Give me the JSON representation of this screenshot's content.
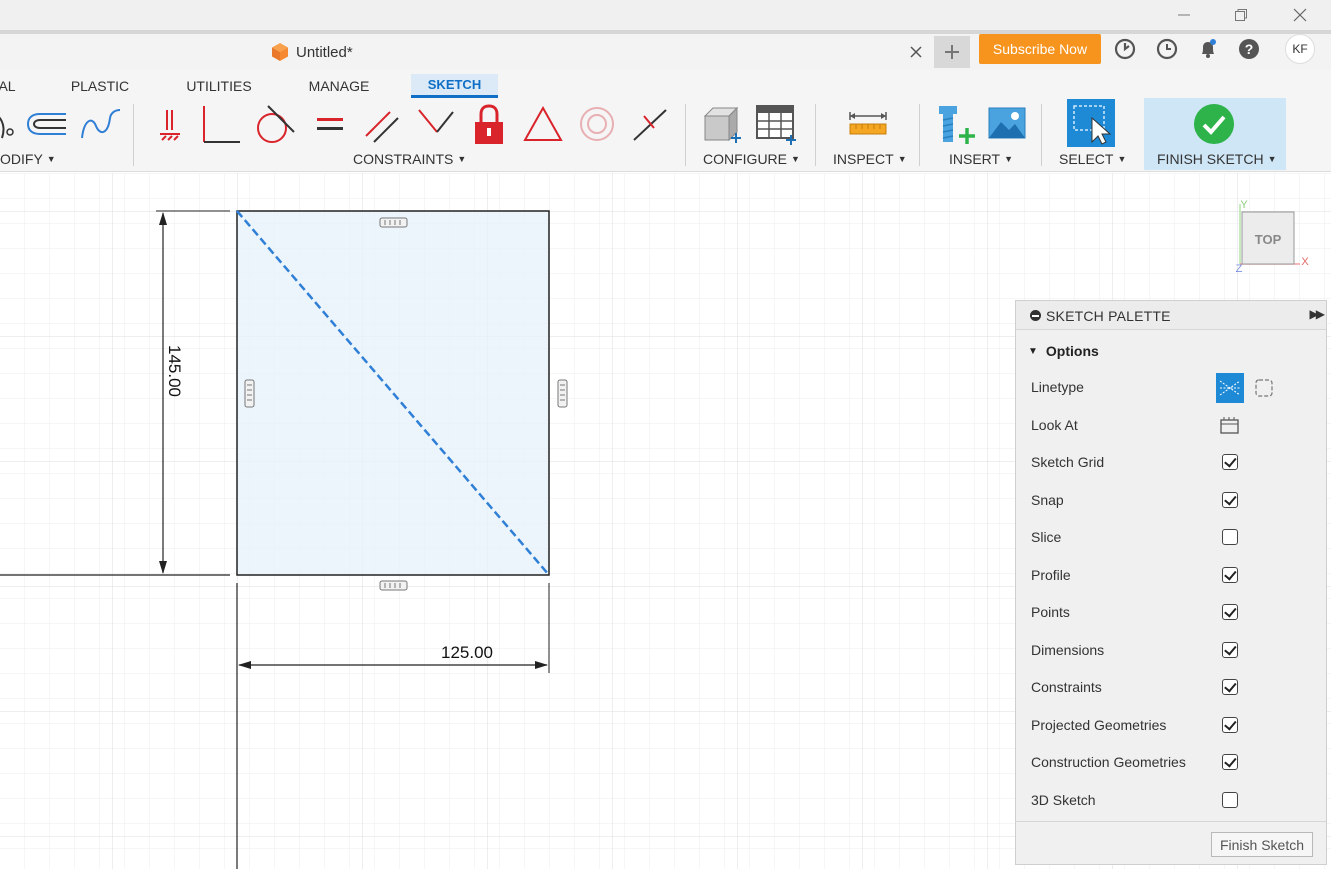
{
  "document": {
    "title": "Untitled*"
  },
  "header": {
    "subscribe_label": "Subscribe Now",
    "avatar_initials": "KF"
  },
  "ribbon_tabs": [
    {
      "label": "AL"
    },
    {
      "label": "PLASTIC"
    },
    {
      "label": "UTILITIES"
    },
    {
      "label": "MANAGE"
    },
    {
      "label": "SKETCH",
      "active": true
    }
  ],
  "toolbar": {
    "groups": {
      "modify": "ODIFY",
      "constraints": "CONSTRAINTS",
      "configure": "CONFIGURE",
      "inspect": "INSPECT",
      "insert": "INSERT",
      "select": "SELECT",
      "finish_sketch": "FINISH SKETCH"
    }
  },
  "sketch": {
    "dimension_vertical": "145.00",
    "dimension_horizontal": "125.00"
  },
  "viewcube": {
    "face": "TOP",
    "axis_x": "X",
    "axis_y": "Y",
    "axis_z": "Z"
  },
  "palette": {
    "title": "SKETCH PALETTE",
    "section": "Options",
    "linetype_label": "Linetype",
    "look_at_label": "Look At",
    "options": [
      {
        "label": "Sketch Grid",
        "checked": true
      },
      {
        "label": "Snap",
        "checked": true
      },
      {
        "label": "Slice",
        "checked": false
      },
      {
        "label": "Profile",
        "checked": true
      },
      {
        "label": "Points",
        "checked": true
      },
      {
        "label": "Dimensions",
        "checked": true
      },
      {
        "label": "Constraints",
        "checked": true
      },
      {
        "label": "Projected Geometries",
        "checked": true
      },
      {
        "label": "Construction Geometries",
        "checked": true
      },
      {
        "label": "3D Sketch",
        "checked": false
      }
    ],
    "finish_button": "Finish Sketch"
  },
  "colors": {
    "accent": "#0f6fc6",
    "subscribe": "#f7941d",
    "constraint_red": "#d9242b",
    "finish_green": "#2db34a",
    "construction_line": "#2f7fd6"
  }
}
